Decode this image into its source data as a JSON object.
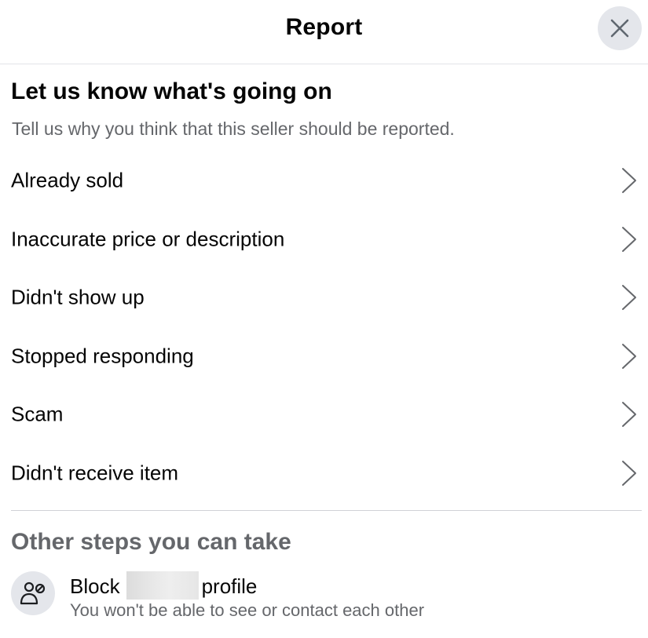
{
  "header": {
    "title": "Report",
    "close_icon": "close-icon"
  },
  "section": {
    "title": "Let us know what's going on",
    "subtitle": "Tell us why you think that this seller should be reported."
  },
  "options": [
    {
      "label": "Already sold",
      "icon": "chevron-right-icon"
    },
    {
      "label": "Inaccurate price or description",
      "icon": "chevron-right-icon"
    },
    {
      "label": "Didn't show up",
      "icon": "chevron-right-icon"
    },
    {
      "label": "Stopped responding",
      "icon": "chevron-right-icon"
    },
    {
      "label": "Scam",
      "icon": "chevron-right-icon"
    },
    {
      "label": "Didn't receive item",
      "icon": "chevron-right-icon"
    }
  ],
  "other_steps": {
    "title": "Other steps you can take",
    "block": {
      "label_prefix": "Block",
      "label_suffix": "profile",
      "subtitle": "You won't be able to see or contact each other",
      "icon": "block-person-icon"
    }
  },
  "colors": {
    "text_primary": "#050505",
    "text_secondary": "#65676b",
    "icon_circle_bg": "#e4e6eb",
    "divider": "#d0d2d6"
  }
}
